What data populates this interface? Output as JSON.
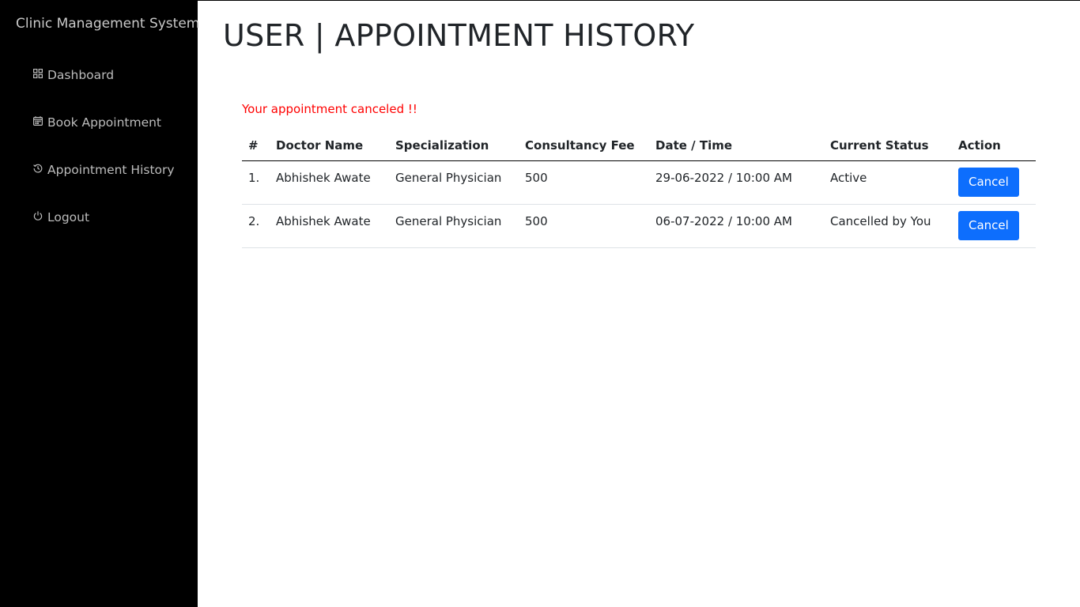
{
  "sidebar": {
    "brand": "Clinic Management System",
    "items": [
      {
        "label": "Dashboard",
        "icon": "grid-icon"
      },
      {
        "label": "Book Appointment",
        "icon": "calendar-icon"
      },
      {
        "label": "Appointment History",
        "icon": "history-icon"
      },
      {
        "label": "Logout",
        "icon": "power-icon"
      }
    ]
  },
  "page": {
    "title": "USER | APPOINTMENT HISTORY",
    "alert": "Your appointment canceled !!"
  },
  "table": {
    "headers": [
      "#",
      "Doctor Name",
      "Specialization",
      "Consultancy Fee",
      "Date / Time",
      "Current Status",
      "Action"
    ],
    "rows": [
      {
        "num": "1.",
        "doctor": "Abhishek Awate",
        "specialization": "General Physician",
        "fee": "500",
        "datetime": "29-06-2022 / 10:00 AM",
        "status": "Active",
        "action": "Cancel"
      },
      {
        "num": "2.",
        "doctor": "Abhishek Awate",
        "specialization": "General Physician",
        "fee": "500",
        "datetime": "06-07-2022 / 10:00 AM",
        "status": "Cancelled by You",
        "action": "Cancel"
      }
    ]
  },
  "colors": {
    "sidebar_bg": "#000000",
    "alert": "#ff0000",
    "button": "#0d6efd"
  }
}
